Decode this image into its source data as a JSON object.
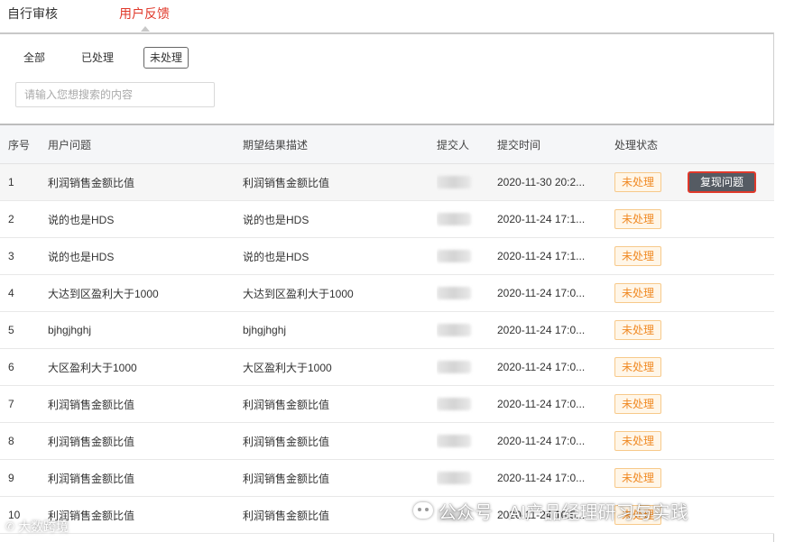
{
  "tabs": [
    {
      "label": "自行审核"
    },
    {
      "label": "用户反馈"
    }
  ],
  "filters": {
    "all": "全部",
    "processed": "已处理",
    "unprocessed": "未处理"
  },
  "search": {
    "placeholder": "请输入您想搜索的内容",
    "value": ""
  },
  "table": {
    "headers": {
      "index": "序号",
      "question": "用户问题",
      "expected": "期望结果描述",
      "submitter": "提交人",
      "time": "提交时间",
      "status": "处理状态"
    },
    "rows": [
      {
        "index": "1",
        "question": "利润销售金额比值",
        "expected": "利润销售金额比值",
        "time": "2020-11-30 20:2...",
        "status": "未处理",
        "action": "复现问题"
      },
      {
        "index": "2",
        "question": "说的也是HDS",
        "expected": "说的也是HDS",
        "time": "2020-11-24 17:1...",
        "status": "未处理"
      },
      {
        "index": "3",
        "question": "说的也是HDS",
        "expected": "说的也是HDS",
        "time": "2020-11-24 17:1...",
        "status": "未处理"
      },
      {
        "index": "4",
        "question": "大达到区盈利大于1000",
        "expected": "大达到区盈利大于1000",
        "time": "2020-11-24 17:0...",
        "status": "未处理"
      },
      {
        "index": "5",
        "question": "bjhgjhghj",
        "expected": "bjhgjhghj",
        "time": "2020-11-24 17:0...",
        "status": "未处理"
      },
      {
        "index": "6",
        "question": "大区盈利大于1000",
        "expected": "大区盈利大于1000",
        "time": "2020-11-24 17:0...",
        "status": "未处理"
      },
      {
        "index": "7",
        "question": "利润销售金额比值",
        "expected": "利润销售金额比值",
        "time": "2020-11-24 17:0...",
        "status": "未处理"
      },
      {
        "index": "8",
        "question": "利润销售金额比值",
        "expected": "利润销售金额比值",
        "time": "2020-11-24 17:0...",
        "status": "未处理"
      },
      {
        "index": "9",
        "question": "利润销售金额比值",
        "expected": "利润销售金额比值",
        "time": "2020-11-24 17:0...",
        "status": "未处理"
      },
      {
        "index": "10",
        "question": "利润销售金额比值",
        "expected": "利润销售金额比值",
        "time": "2020-11-24 16:5...",
        "status": "未处理"
      }
    ]
  },
  "watermark": {
    "text": "公众号 · AI产品经理研习与实践",
    "logo_text": "大数跨境"
  },
  "colors": {
    "active_tab": "#e0392b",
    "status_text": "#f08a24",
    "status_bg": "#fff6e8",
    "action_bg": "#555b63",
    "action_border": "#e0392b"
  }
}
